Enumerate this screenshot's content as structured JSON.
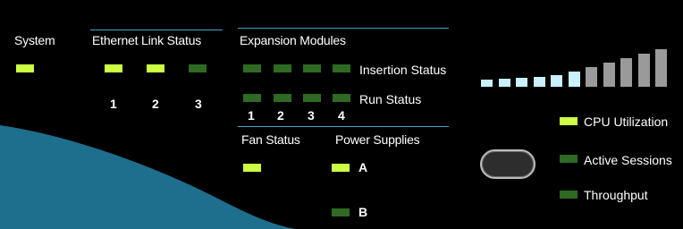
{
  "sections": {
    "system": "System",
    "ethernet": "Ethernet Link Status",
    "expansion": "Expansion Modules",
    "fan": "Fan Status",
    "power": "Power Supplies"
  },
  "ethernet_ports": [
    {
      "number": "1",
      "status": "on"
    },
    {
      "number": "2",
      "status": "on"
    },
    {
      "number": "3",
      "status": "off"
    }
  ],
  "expansion_modules": {
    "numbers": [
      "1",
      "2",
      "3",
      "4"
    ],
    "insertion_label": "Insertion Status",
    "run_label": "Run Status"
  },
  "power_supplies": {
    "a_label": "A",
    "b_label": "B"
  },
  "legend": {
    "cpu": "CPU Utilization",
    "sessions": "Active Sessions",
    "throughput": "Throughput"
  },
  "meter": {
    "lit_segments": 6,
    "total_segments": 11
  },
  "colors": {
    "led_on": "#ccff44",
    "led_off": "#2f6a22",
    "meter_lit": "#c8f0ff",
    "meter_unlit": "#9a9a9a",
    "accent_line": "#3ea7c7"
  }
}
